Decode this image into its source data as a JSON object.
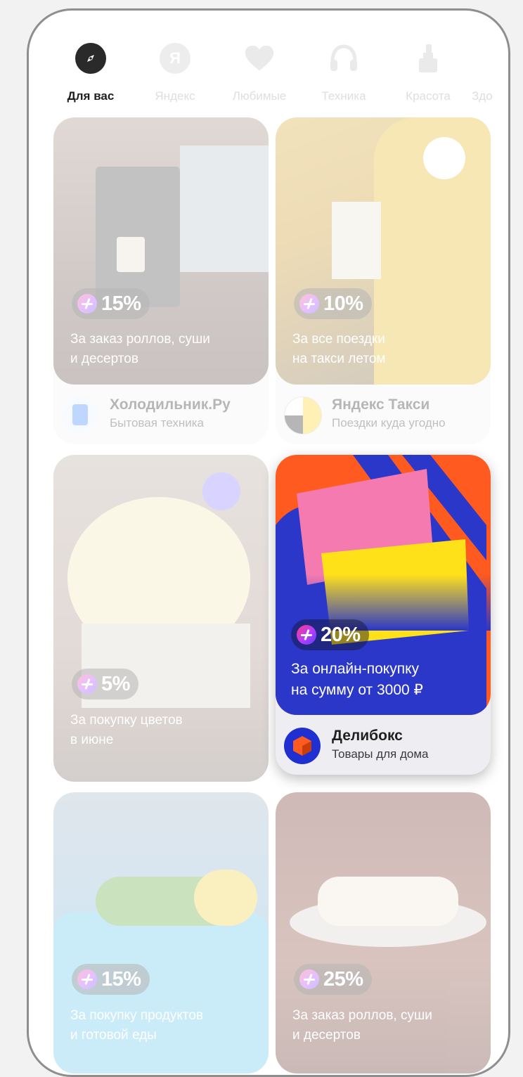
{
  "tabs": [
    {
      "label": "Для вас",
      "icon": "compass-icon",
      "active": true
    },
    {
      "label": "Яндекс",
      "icon": "yandex-icon"
    },
    {
      "label": "Любимые",
      "icon": "heart-icon"
    },
    {
      "label": "Техника",
      "icon": "headphones-icon"
    },
    {
      "label": "Красота",
      "icon": "beauty-icon"
    },
    {
      "label": "Здо",
      "icon": "health-icon"
    }
  ],
  "cards": {
    "fridge": {
      "discount": "15%",
      "desc_line1": "За заказ роллов, суши",
      "desc_line2": "и десертов",
      "brand": "Холодильник.Ру",
      "sub": "Бытовая техника"
    },
    "taxi": {
      "discount": "10%",
      "desc_line1": "За все поездки",
      "desc_line2": "на такси летом",
      "brand": "Яндекс Такси",
      "sub": "Поездки куда угодно"
    },
    "flowers": {
      "discount": "5%",
      "desc_line1": "За покупку цветов",
      "desc_line2": "в июне"
    },
    "delibox": {
      "discount": "20%",
      "desc_line1": "За онлайн-покупку",
      "desc_line2": "на сумму от 3000 ₽",
      "brand": "Делибокс",
      "sub": "Товары для дома"
    },
    "grocery": {
      "discount": "15%",
      "desc_line1": "За покупку продуктов",
      "desc_line2": "и готовой еды"
    },
    "sushi": {
      "discount": "25%",
      "desc_line1": "За заказ роллов, суши",
      "desc_line2": "и десертов"
    }
  },
  "colors": {
    "accent_gradient_start": "#ff3d7f",
    "accent_gradient_end": "#5a43ff",
    "delibox_blue": "#2b37c8",
    "delibox_orange": "#ff5a1f",
    "taxi_yellow": "#ffd21f"
  }
}
